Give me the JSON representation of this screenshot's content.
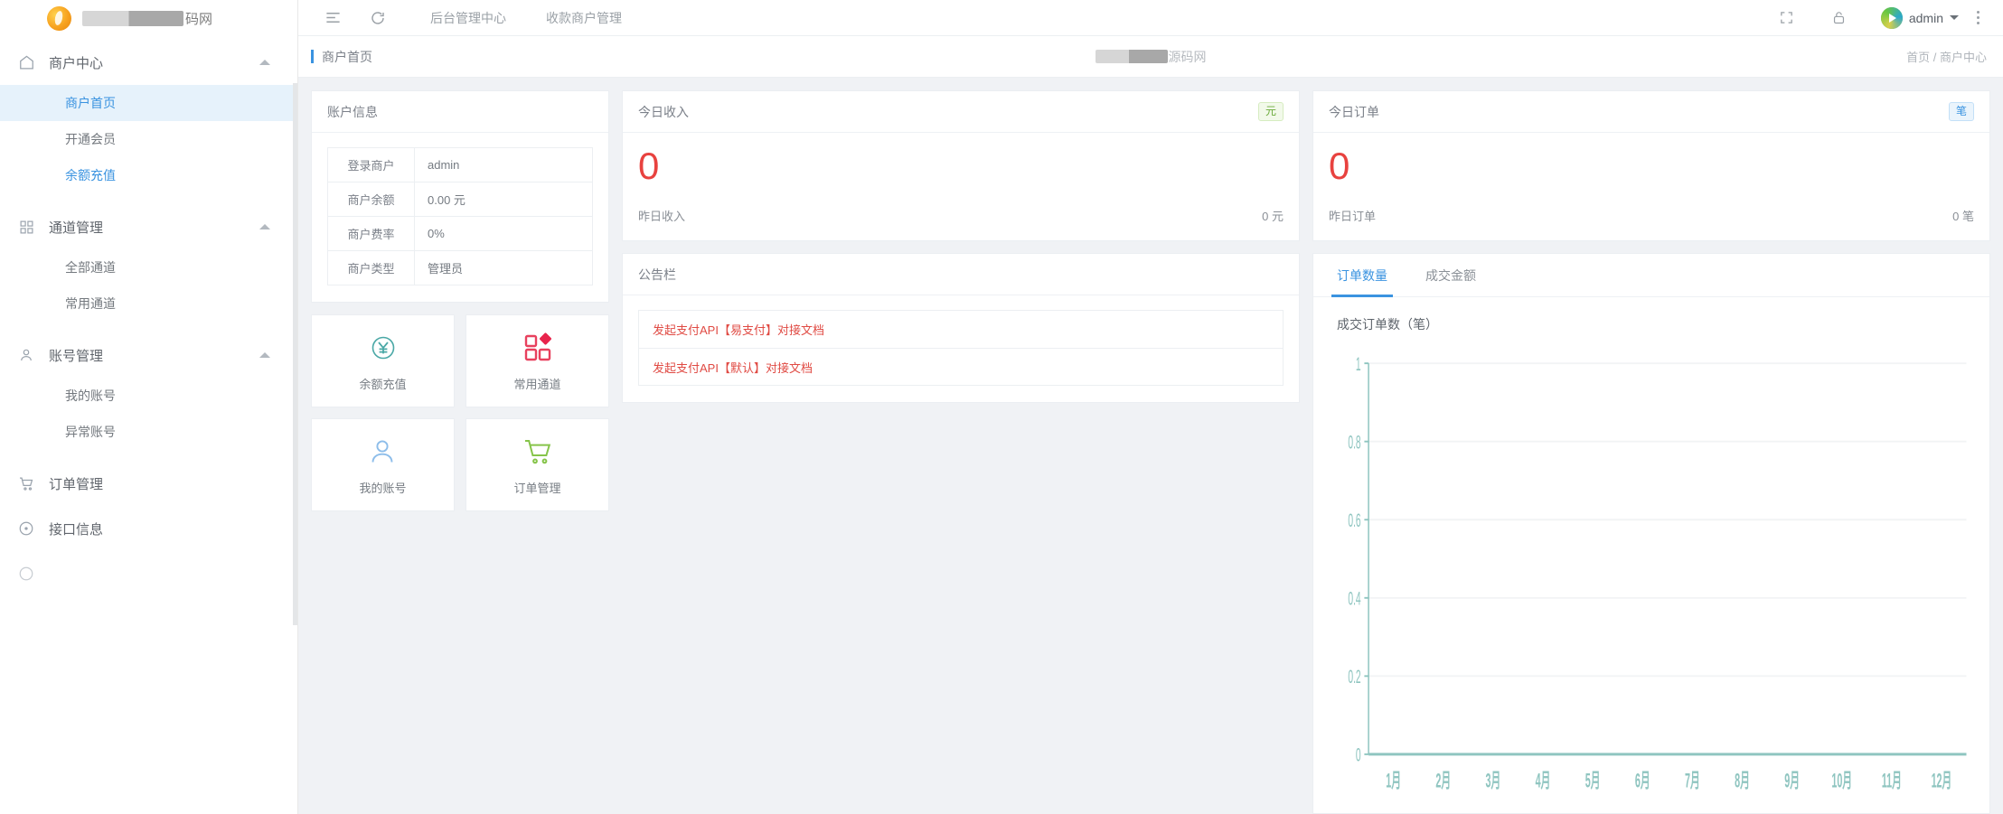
{
  "sidebar": {
    "logo": {
      "redacted": true,
      "suffix": "码网"
    },
    "groups": [
      {
        "label": "商户中心",
        "icon": "home-icon",
        "items": [
          {
            "label": "商户首页",
            "state": "active"
          },
          {
            "label": "开通会员",
            "state": "normal"
          },
          {
            "label": "余额充值",
            "state": "link"
          }
        ]
      },
      {
        "label": "通道管理",
        "icon": "grid-icon",
        "items": [
          {
            "label": "全部通道",
            "state": "normal"
          },
          {
            "label": "常用通道",
            "state": "normal"
          }
        ]
      },
      {
        "label": "账号管理",
        "icon": "user-icon",
        "items": [
          {
            "label": "我的账号",
            "state": "normal"
          },
          {
            "label": "异常账号",
            "state": "normal"
          }
        ]
      }
    ],
    "single_items": [
      {
        "label": "订单管理",
        "icon": "cart-icon"
      },
      {
        "label": "接口信息",
        "icon": "clock-icon"
      }
    ]
  },
  "topbar": {
    "menu_icon": "list-menu-icon",
    "refresh_icon": "refresh-icon",
    "tabs": [
      {
        "label": "后台管理中心"
      },
      {
        "label": "收款商户管理"
      }
    ],
    "fullscreen_icon": "fullscreen-icon",
    "lock_icon": "lock-icon",
    "user_name": "admin",
    "more_icon": "more-vertical-icon"
  },
  "breadcrumb": {
    "page_title": "商户首页",
    "center_suffix": "源码网",
    "path": "首页 / 商户中心"
  },
  "account_card": {
    "title": "账户信息",
    "rows": [
      {
        "key": "登录商户",
        "value": "admin"
      },
      {
        "key": "商户余额",
        "value": "0.00 元"
      },
      {
        "key": "商户费率",
        "value": "0%"
      },
      {
        "key": "商户类型",
        "value": "管理员"
      }
    ]
  },
  "tiles": [
    {
      "label": "余额充值",
      "icon": "yen-circle-icon",
      "color": "#4aa8a6"
    },
    {
      "label": "常用通道",
      "icon": "grid-squares-icon",
      "color": "#e8415e"
    },
    {
      "label": "我的账号",
      "icon": "user-avatar-icon",
      "color": "#8dbdea"
    },
    {
      "label": "订单管理",
      "icon": "shopping-cart-icon",
      "color": "#86c44a"
    }
  ],
  "income_card": {
    "title": "今日收入",
    "badge": "元",
    "value": "0",
    "footer_label": "昨日收入",
    "footer_value": "0 元"
  },
  "orders_card": {
    "title": "今日订单",
    "badge": "笔",
    "value": "0",
    "footer_label": "昨日订单",
    "footer_value": "0 笔"
  },
  "notice_card": {
    "title": "公告栏",
    "items": [
      {
        "label": "发起支付API【易支付】对接文档"
      },
      {
        "label": "发起支付API【默认】对接文档"
      }
    ]
  },
  "chart_card": {
    "tabs": [
      {
        "label": "订单数量",
        "active": true
      },
      {
        "label": "成交金额",
        "active": false
      }
    ]
  },
  "chart_data": {
    "type": "line",
    "title": "成交订单数（笔）",
    "categories": [
      "1月",
      "2月",
      "3月",
      "4月",
      "5月",
      "6月",
      "7月",
      "8月",
      "9月",
      "10月",
      "11月",
      "12月"
    ],
    "values": [
      0,
      0,
      0,
      0,
      0,
      0,
      0,
      0,
      0,
      0,
      0,
      0
    ],
    "yticks": [
      "0",
      "0.2",
      "0.4",
      "0.6",
      "0.8",
      "1"
    ],
    "ylim": [
      0,
      1
    ],
    "xlabel": "",
    "ylabel": "",
    "grid": true,
    "legend": "none",
    "axis_color": "#8fc5c0",
    "series": [
      {
        "name": "成交订单数（笔）",
        "values": [
          0,
          0,
          0,
          0,
          0,
          0,
          0,
          0,
          0,
          0,
          0,
          0
        ]
      }
    ]
  },
  "colors": {
    "accent": "#3a93e0",
    "danger": "#e8423f",
    "notice": "#e04a43",
    "chart_axis": "#8fc5c0",
    "badge_green": "#6aaa3a",
    "badge_blue": "#3a93e0"
  }
}
